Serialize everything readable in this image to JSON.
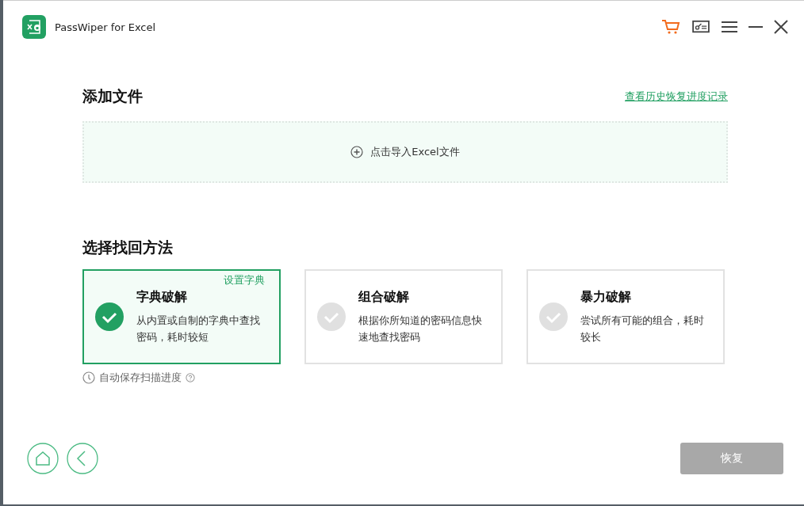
{
  "window": {
    "title": "PassWiper for Excel"
  },
  "add_file": {
    "heading": "添加文件",
    "history_link": "查看历史恢复进度记录",
    "drop_label": "点击导入Excel文件"
  },
  "method": {
    "heading": "选择找回方法",
    "cards": [
      {
        "title": "字典破解",
        "description": "从内置或自制的字典中查找密码，耗时较短",
        "selected": true,
        "action": "设置字典"
      },
      {
        "title": "组合破解",
        "description": "根据你所知道的密码信息快速地查找密码",
        "selected": false
      },
      {
        "title": "暴力破解",
        "description": "尝试所有可能的组合，耗时较长",
        "selected": false
      }
    ],
    "autosave_note": "自动保存扫描进度"
  },
  "footer": {
    "restore_button": {
      "label": "恢复",
      "disabled": true
    }
  }
}
